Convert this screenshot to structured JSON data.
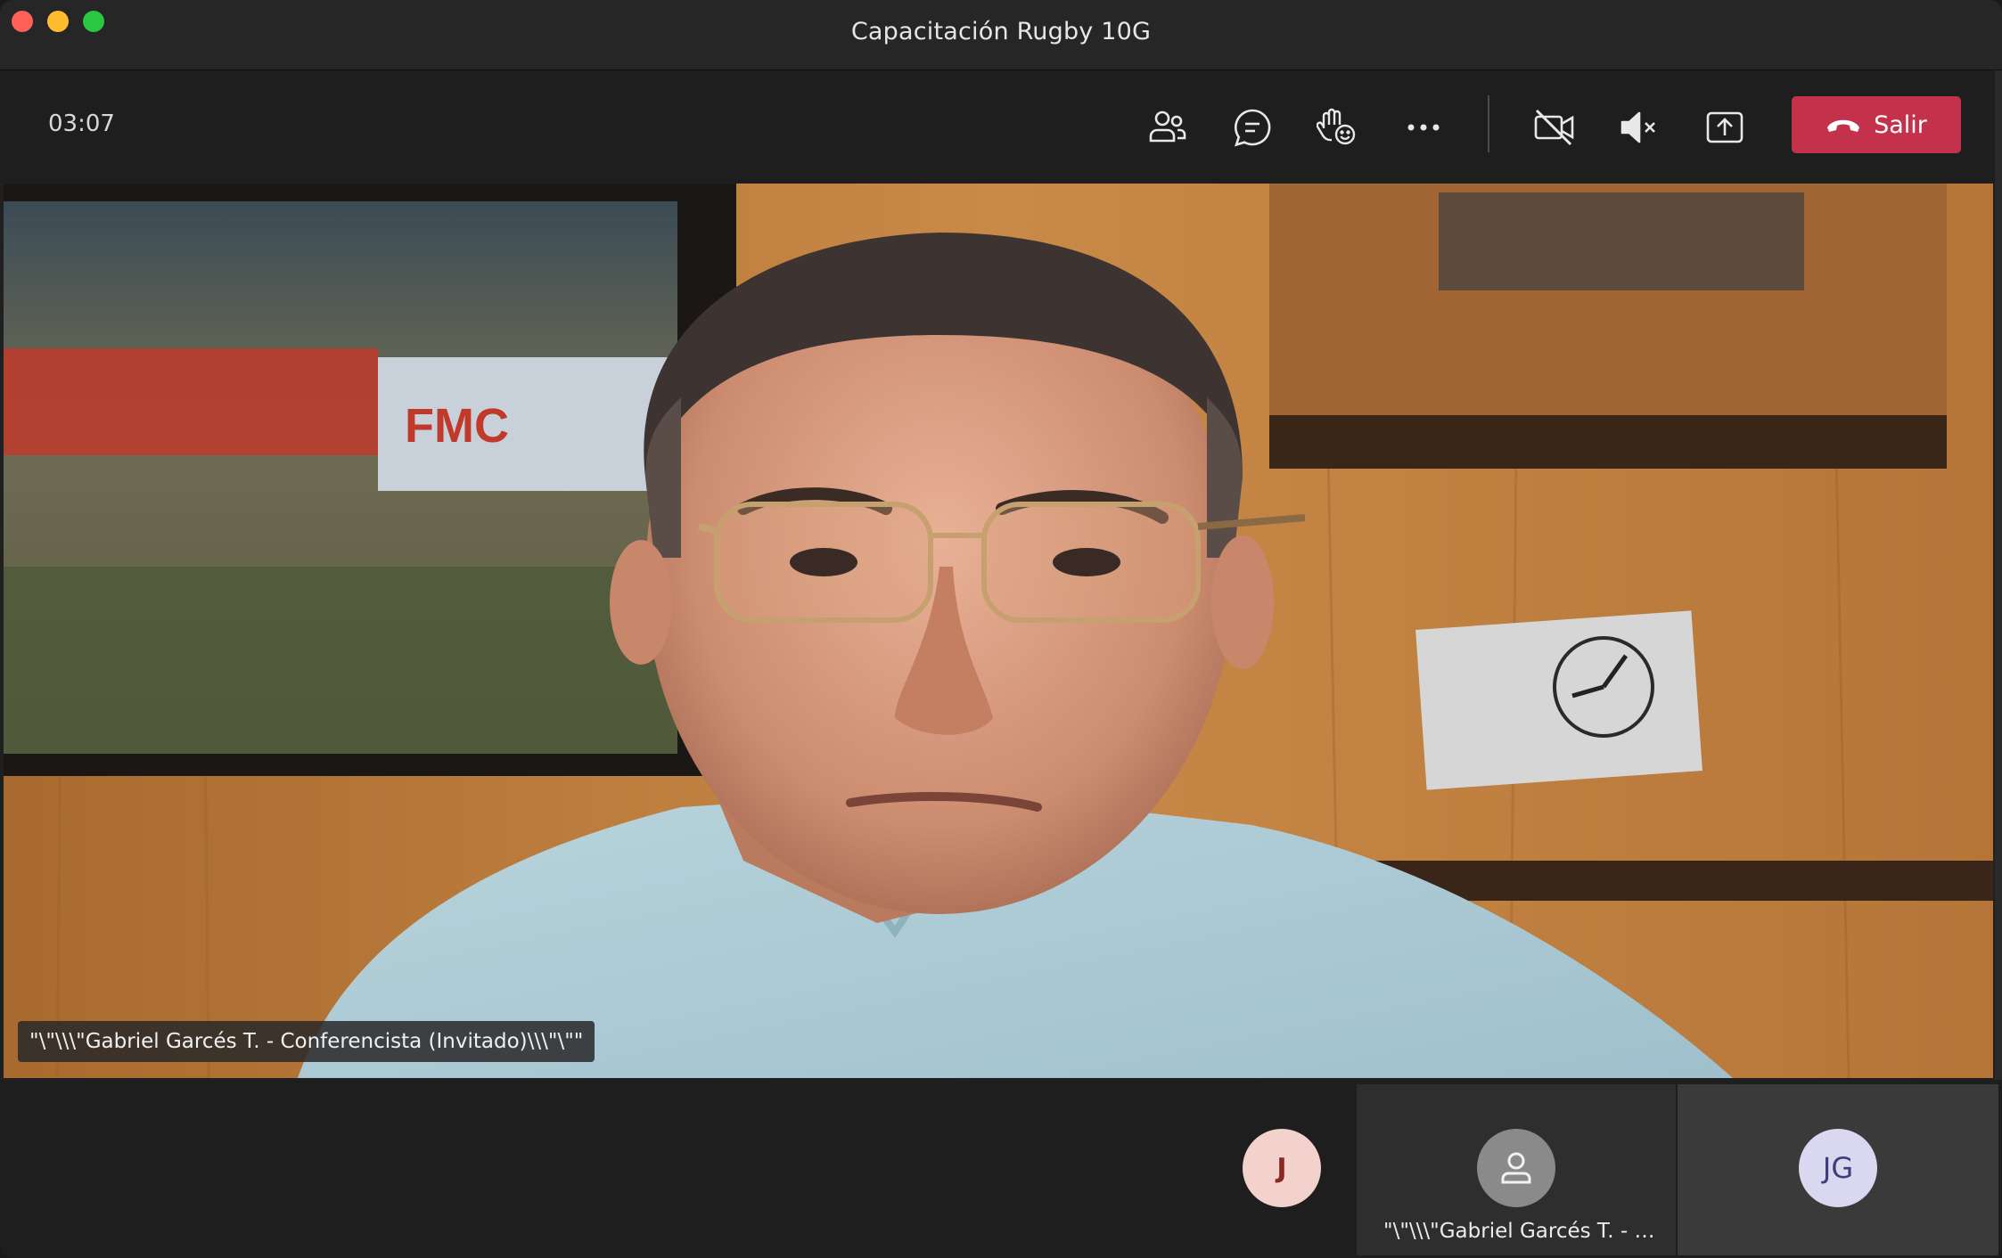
{
  "window": {
    "title": "Capacitación Rugby 10G"
  },
  "toolbar": {
    "timer": "03:07",
    "buttons": [
      {
        "name": "participants",
        "icon": "people-icon"
      },
      {
        "name": "chat",
        "icon": "chat-icon"
      },
      {
        "name": "reactions",
        "icon": "raise-hand-icon"
      },
      {
        "name": "more",
        "icon": "more-icon"
      },
      {
        "name": "camera",
        "icon": "camera-off-icon"
      },
      {
        "name": "mic",
        "icon": "mic-muted-icon"
      },
      {
        "name": "share",
        "icon": "share-screen-icon"
      }
    ],
    "leave_label": "Salir",
    "leave_color": "#c4314b"
  },
  "main_video": {
    "speaker_label": "\"\\\"\\\\\\\"Gabriel Garcés T. - Conferencista (Invitado)\\\\\\\"\\\"\"",
    "screen_logo": "FMC"
  },
  "gallery": {
    "tiles": [
      {
        "initials": "J",
        "avatar_color": "#f3d1cd"
      },
      {
        "label": "\"\\\"\\\\\\\"Gabriel Garcés T. - C...",
        "avatar_icon": "person-icon"
      },
      {
        "initials": "JG",
        "avatar_color": "#d9d8f0"
      }
    ]
  }
}
